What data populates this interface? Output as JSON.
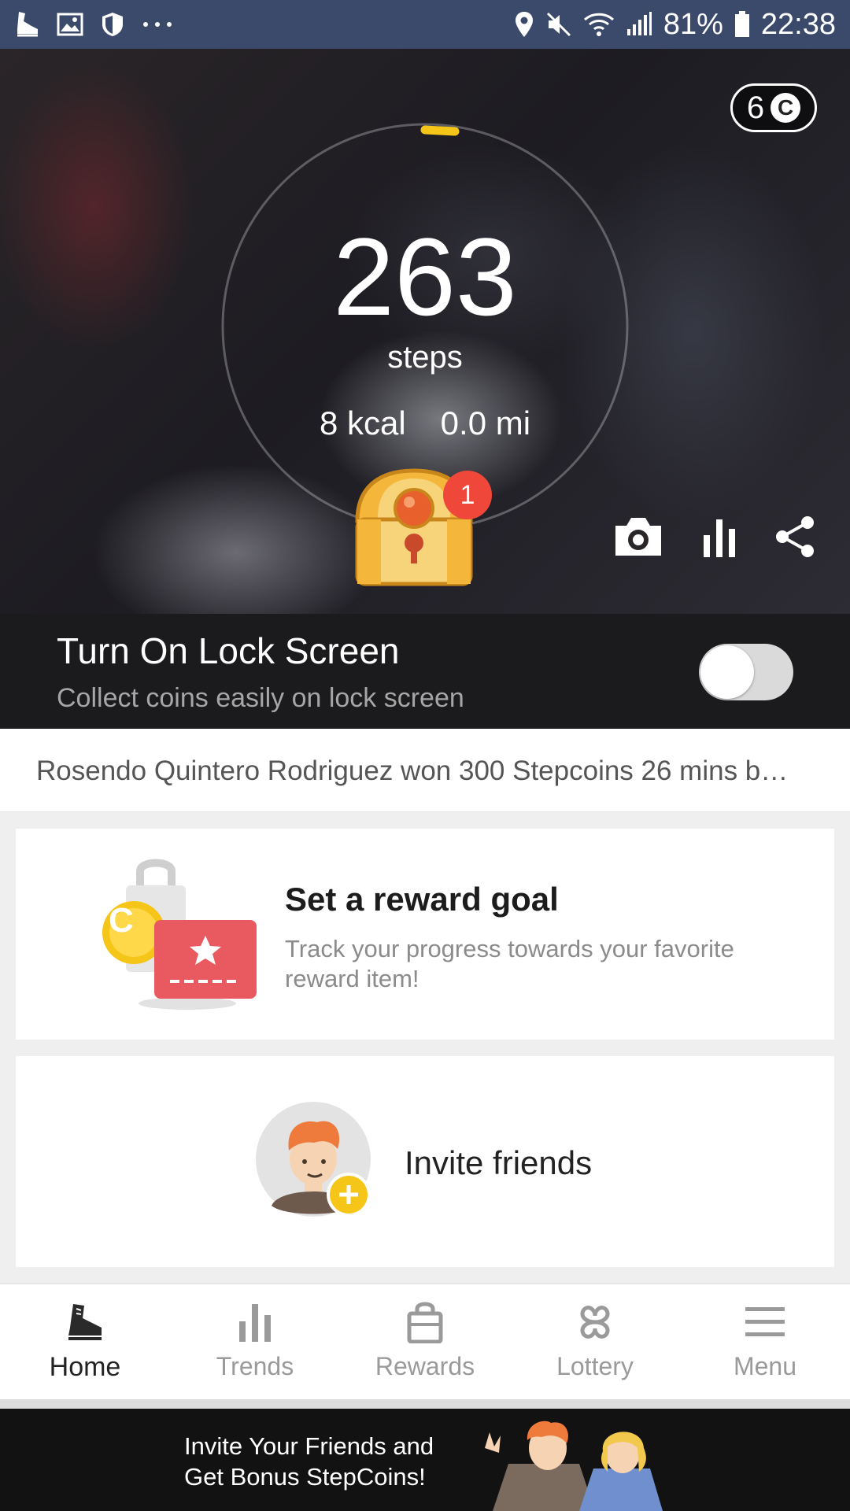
{
  "status_bar": {
    "battery": "81%",
    "time": "22:38",
    "icons": [
      "shoe-app-icon",
      "gallery-icon",
      "shield-icon",
      "more-dots-icon",
      "location-icon",
      "mute-icon",
      "wifi-icon",
      "signal-icon",
      "battery-icon"
    ]
  },
  "hero": {
    "coin_count": "6",
    "coin_symbol": "C",
    "steps": "263",
    "steps_label": "steps",
    "kcal": "8 kcal",
    "distance": "0.0 mi",
    "chest_badge": "1",
    "ring_progress_color": "#f5c518"
  },
  "lock_screen": {
    "title": "Turn On Lock Screen",
    "subtitle": "Collect coins easily on lock screen",
    "toggle_on": false
  },
  "ticker": {
    "text": "Rosendo Quintero Rodriguez won 300 Stepcoins 26 mins b…"
  },
  "goal_card": {
    "title": "Set a reward goal",
    "description": "Track your progress towards your favorite reward item!",
    "coin_symbol": "C"
  },
  "invite_card": {
    "label": "Invite friends"
  },
  "tabs": [
    {
      "label": "Home",
      "icon": "shoe-icon",
      "active": true
    },
    {
      "label": "Trends",
      "icon": "bar-chart-icon",
      "active": false
    },
    {
      "label": "Rewards",
      "icon": "shopping-bag-icon",
      "active": false
    },
    {
      "label": "Lottery",
      "icon": "clover-icon",
      "active": false
    },
    {
      "label": "Menu",
      "icon": "hamburger-icon",
      "active": false
    }
  ],
  "banner": {
    "text_line1": "Invite Your Friends and",
    "text_line2": "Get Bonus StepCoins!"
  },
  "colors": {
    "status_bar": "#3b4a6b",
    "accent_yellow": "#f5c518",
    "badge_red": "#f0473b",
    "goal_red": "#e85a5f"
  }
}
